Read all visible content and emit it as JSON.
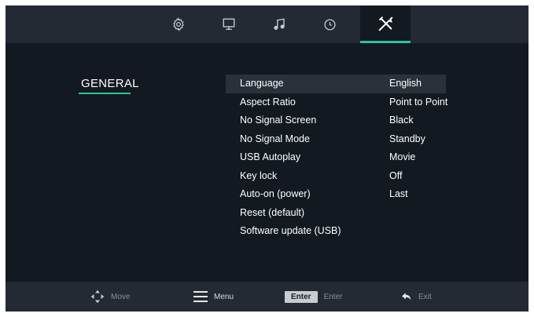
{
  "tabs": [
    {
      "icon": "gear-icon",
      "active": false
    },
    {
      "icon": "monitor-icon",
      "active": false
    },
    {
      "icon": "music-note-icon",
      "active": false
    },
    {
      "icon": "clock-icon",
      "active": false
    },
    {
      "icon": "tools-icon",
      "active": true
    }
  ],
  "section": {
    "title": "GENERAL"
  },
  "settings": [
    {
      "label": "Language",
      "value": "English"
    },
    {
      "label": "Aspect Ratio",
      "value": "Point to Point"
    },
    {
      "label": "No Signal Screen",
      "value": "Black"
    },
    {
      "label": "No Signal Mode",
      "value": "Standby"
    },
    {
      "label": "USB Autoplay",
      "value": "Movie"
    },
    {
      "label": "Key lock",
      "value": "Off"
    },
    {
      "label": "Auto-on (power)",
      "value": "Last"
    },
    {
      "label": "Reset (default)",
      "value": ""
    },
    {
      "label": "Software update (USB)",
      "value": ""
    }
  ],
  "hints": {
    "move": "Move",
    "menu": "Menu",
    "enter_key": "Enter",
    "enter": "Enter",
    "exit": "Exit"
  },
  "colors": {
    "accent": "#2fc39a",
    "background": "#121921",
    "bar": "#232a33"
  }
}
